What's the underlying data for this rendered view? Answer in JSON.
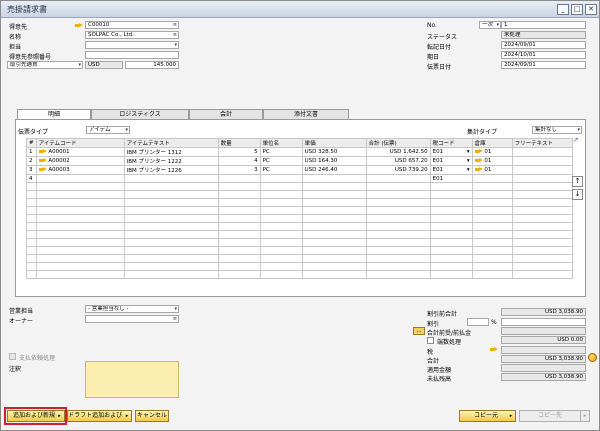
{
  "window": {
    "title": "売掛請求書"
  },
  "header": {
    "customer_label": "得意先",
    "customer_value": "C00010",
    "name_label": "名称",
    "name_value": "SOLPAC Co., Ltd.",
    "contact_label": "担当",
    "contact_value": "",
    "ref_label": "得意先参照番号",
    "ref_value": "",
    "currency_label": "取引先通貨",
    "currency_code": "USD",
    "currency_rate": "145.000"
  },
  "doc": {
    "no_label": "No.",
    "no_series": "一次",
    "no_value": "1",
    "status_label": "ステータス",
    "status_value": "未処理",
    "posting_label": "転記日付",
    "posting_value": "2024/09/01",
    "due_label": "期日",
    "due_value": "2024/10/01",
    "docdate_label": "伝票日付",
    "docdate_value": "2024/09/01"
  },
  "tabs": [
    "明細",
    "ロジスティクス",
    "会計",
    "添付文書"
  ],
  "grid_options": {
    "type_label": "伝票タイプ",
    "type_value": "アイテム",
    "summary_label": "集計タイプ",
    "summary_value": "集計なし"
  },
  "table": {
    "headers": [
      "#",
      "アイテムコード",
      "アイテムテキスト",
      "数量",
      "単位名",
      "単価",
      "合計 (伝票)",
      "税コード",
      "倉庫",
      "フリーテキスト"
    ],
    "rows": [
      {
        "num": "1",
        "code": "A00001",
        "text": "IBM プリンター 1312",
        "qty": "5",
        "unit": "PC",
        "price": "USD 328.50",
        "total": "USD 1,642.50",
        "tax": "E01",
        "wh": "01"
      },
      {
        "num": "2",
        "code": "A00002",
        "text": "IBM プリンター 1222",
        "qty": "4",
        "unit": "PC",
        "price": "USD 164.30",
        "total": "USD 657.20",
        "tax": "E01",
        "wh": "01"
      },
      {
        "num": "3",
        "code": "A00003",
        "text": "IBM プリンター 1226",
        "qty": "3",
        "unit": "PC",
        "price": "USD 246.40",
        "total": "USD 739.20",
        "tax": "E01",
        "wh": "01"
      },
      {
        "num": "4",
        "code": "",
        "text": "",
        "qty": "",
        "unit": "",
        "price": "",
        "total": "",
        "tax": "E01",
        "wh": ""
      }
    ]
  },
  "footer_left": {
    "sales_label": "営業担当",
    "sales_value": "- 営業担当なし -",
    "owner_label": "オーナー",
    "owner_value": "",
    "approval_label": "支払依頼処理",
    "remarks_label": "注釈"
  },
  "totals": {
    "subtotal_label": "割引前合計",
    "subtotal_value": "USD 3,038.90",
    "discount_label": "割引",
    "discount_unit": "%",
    "advance_label": "合計前受/前払金",
    "advance_btn": "...",
    "rounding_label": "端数処理",
    "rounding_value": "USD 0.00",
    "tax_label": "税",
    "total_label": "合計",
    "total_value": "USD 3,038.90",
    "applied_label": "適用金額",
    "balance_label": "未払残高",
    "balance_value": "USD 3,038.90"
  },
  "buttons": {
    "add_new": "追加および新規",
    "draft_add": "ドラフト追加および...",
    "cancel": "キャンセル",
    "copy_from": "コピー元",
    "copy_to": "コピー先"
  }
}
